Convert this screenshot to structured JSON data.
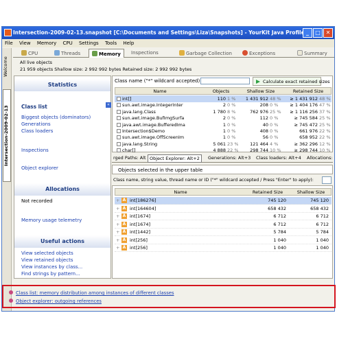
{
  "window": {
    "title": "Intersection-2009-02-13.snapshot [C:\\Documents and Settings\\Liza\\Snapshots] - YourKit Java Profile...",
    "controls": {
      "minimize": "_",
      "maximize": "□",
      "close": "✕"
    }
  },
  "menu": [
    "File",
    "View",
    "Memory",
    "CPU",
    "Settings",
    "Tools",
    "Help"
  ],
  "vertical_tabs": {
    "welcome": "Welcome",
    "snapshot": "Intersection-2009-02-13"
  },
  "tabs": [
    {
      "label": "CPU",
      "icon": "cpu-icon"
    },
    {
      "label": "Threads",
      "icon": "threads-icon"
    },
    {
      "label": "Memory",
      "icon": "memory-icon",
      "active": true
    },
    {
      "label": "Inspections",
      "icon": "inspections-icon"
    },
    {
      "label": "Garbage Collection",
      "icon": "gc-icon"
    },
    {
      "label": "Exceptions",
      "icon": "exceptions-icon"
    },
    {
      "label": "Summary",
      "icon": "summary-icon"
    }
  ],
  "summary": {
    "line1": "All live objects",
    "line2": "21 959 objects   Shallow size: 2 992 992 bytes   Retained size: 2 992 992 bytes"
  },
  "left_panel": {
    "statistics_header": "Statistics",
    "class_list": "Class list",
    "links1": [
      "Biggest objects (dominators)",
      "Generations",
      "Class loaders"
    ],
    "inspections": "Inspections",
    "object_explorer": "Object explorer",
    "allocations_header": "Allocations",
    "not_recorded": "Not recorded",
    "telemetry": "Memory usage telemetry",
    "actions_header": "Useful actions",
    "actions": [
      "View selected objects",
      "View retained objects",
      "View instances by class...",
      "Find strings by pattern..."
    ]
  },
  "top_table": {
    "filter_label": "Class name (\"*\" wildcard accepted):",
    "calc_button": "Calculate exact retained sizes",
    "columns": [
      "Name",
      "Objects",
      "Shallow Size",
      "Retained Size"
    ],
    "rows": [
      {
        "name": "int[]",
        "objects": "110",
        "objects_pct": "1 %",
        "shallow": "1 431 912",
        "shallow_pct": "48 %",
        "retained": "≥ 1 431 912",
        "retained_pct": "48 %",
        "selected": true
      },
      {
        "name": "sun.awt.image.IntegerInter",
        "objects": "2",
        "objects_pct": "0 %",
        "shallow": "208",
        "shallow_pct": "0 %",
        "retained": "≥ 1 404 176",
        "retained_pct": "47 %"
      },
      {
        "name": "java.lang.Class",
        "objects": "1 780",
        "objects_pct": "8 %",
        "shallow": "762 976",
        "shallow_pct": "25 %",
        "retained": "≥ 1 116 256",
        "retained_pct": "37 %"
      },
      {
        "name": "sun.awt.image.BufImgSurfa",
        "objects": "2",
        "objects_pct": "0 %",
        "shallow": "112",
        "shallow_pct": "0 %",
        "retained": "≥ 745 584",
        "retained_pct": "25 %"
      },
      {
        "name": "java.awt.image.BufferedIma",
        "objects": "1",
        "objects_pct": "0 %",
        "shallow": "40",
        "shallow_pct": "0 %",
        "retained": "≥ 745 472",
        "retained_pct": "25 %"
      },
      {
        "name": "Intersection$Demo",
        "objects": "1",
        "objects_pct": "0 %",
        "shallow": "408",
        "shallow_pct": "0 %",
        "retained": "661 976",
        "retained_pct": "22 %"
      },
      {
        "name": "sun.awt.image.OffScreenIm",
        "objects": "1",
        "objects_pct": "0 %",
        "shallow": "56",
        "shallow_pct": "0 %",
        "retained": "658 952",
        "retained_pct": "22 %"
      },
      {
        "name": "java.lang.String",
        "objects": "5 061",
        "objects_pct": "23 %",
        "shallow": "121 464",
        "shallow_pct": "4 %",
        "retained": "≥ 362 296",
        "retained_pct": "12 %"
      },
      {
        "name": "char[]",
        "objects": "4 888",
        "objects_pct": "22 %",
        "shallow": "298 744",
        "shallow_pct": "10 %",
        "retained": "≥ 298 744",
        "retained_pct": "10 %"
      }
    ]
  },
  "subtabs": [
    "rged Paths: Alt",
    "Object Explorer: Alt+2",
    "Generations: Alt+3",
    "Class loaders: Alt+4",
    "Allocations:"
  ],
  "info_text": "Objects selected in the upper table",
  "bottom_table": {
    "filter_label": "Class name, string value, thread name or ID (\"*\" wildcard accepted / Press \"Enter\" to apply):",
    "columns": [
      "Name",
      "Retained Size",
      "Shallow Size"
    ],
    "rows": [
      {
        "name": "int[186276]",
        "retained": "745 120",
        "shallow": "745 120",
        "selected": true
      },
      {
        "name": "int[164604]",
        "retained": "658 432",
        "shallow": "658 432"
      },
      {
        "name": "int[1674]",
        "retained": "6 712",
        "shallow": "6 712"
      },
      {
        "name": "int[1674]",
        "retained": "6 712",
        "shallow": "6 712"
      },
      {
        "name": "int[1442]",
        "retained": "5 784",
        "shallow": "5 784"
      },
      {
        "name": "int[256]",
        "retained": "1 040",
        "shallow": "1 040"
      },
      {
        "name": "int[256]",
        "retained": "1 040",
        "shallow": "1 040"
      }
    ]
  },
  "status_links": [
    "Class list: memory distribution among instances of different classes",
    "Object explorer: outgoing references"
  ],
  "colors": {
    "accent": "#2e6be0",
    "highlight": "#d4141e",
    "selection": "#c4d7f5"
  }
}
